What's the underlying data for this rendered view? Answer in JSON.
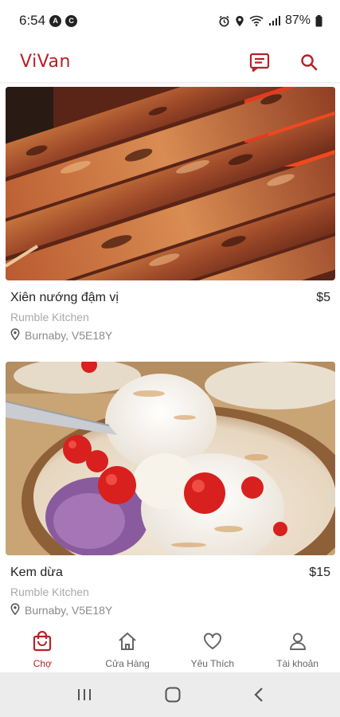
{
  "status": {
    "time": "6:54",
    "badge_a": "A",
    "badge_b": "C",
    "battery": "87%"
  },
  "header": {
    "logo": "ViVan",
    "icons": [
      "message-icon",
      "search-icon"
    ]
  },
  "feed": {
    "items": [
      {
        "title": "Xiên nướng đậm vị",
        "price": "$5",
        "restaurant": "Rumble Kitchen",
        "location": "Burnaby, V5E18Y",
        "image": "grilled-pork-skewers"
      },
      {
        "title": "Kem dừa",
        "price": "$15",
        "restaurant": "Rumble Kitchen",
        "location": "Burnaby, V5E18Y",
        "image": "coconut-ice-cream"
      }
    ]
  },
  "nav": {
    "items": [
      {
        "label": "Chợ",
        "icon": "shopping-bag-icon",
        "active": true
      },
      {
        "label": "Cửa Hàng",
        "icon": "home-icon",
        "active": false
      },
      {
        "label": "Yêu Thích",
        "icon": "heart-icon",
        "active": false
      },
      {
        "label": "Tài khoản",
        "icon": "user-icon",
        "active": false
      }
    ]
  },
  "colors": {
    "accent": "#b5222a",
    "nav_inactive": "#666666",
    "muted_text": "#a9a9a9",
    "system_bar": "#ececec"
  }
}
